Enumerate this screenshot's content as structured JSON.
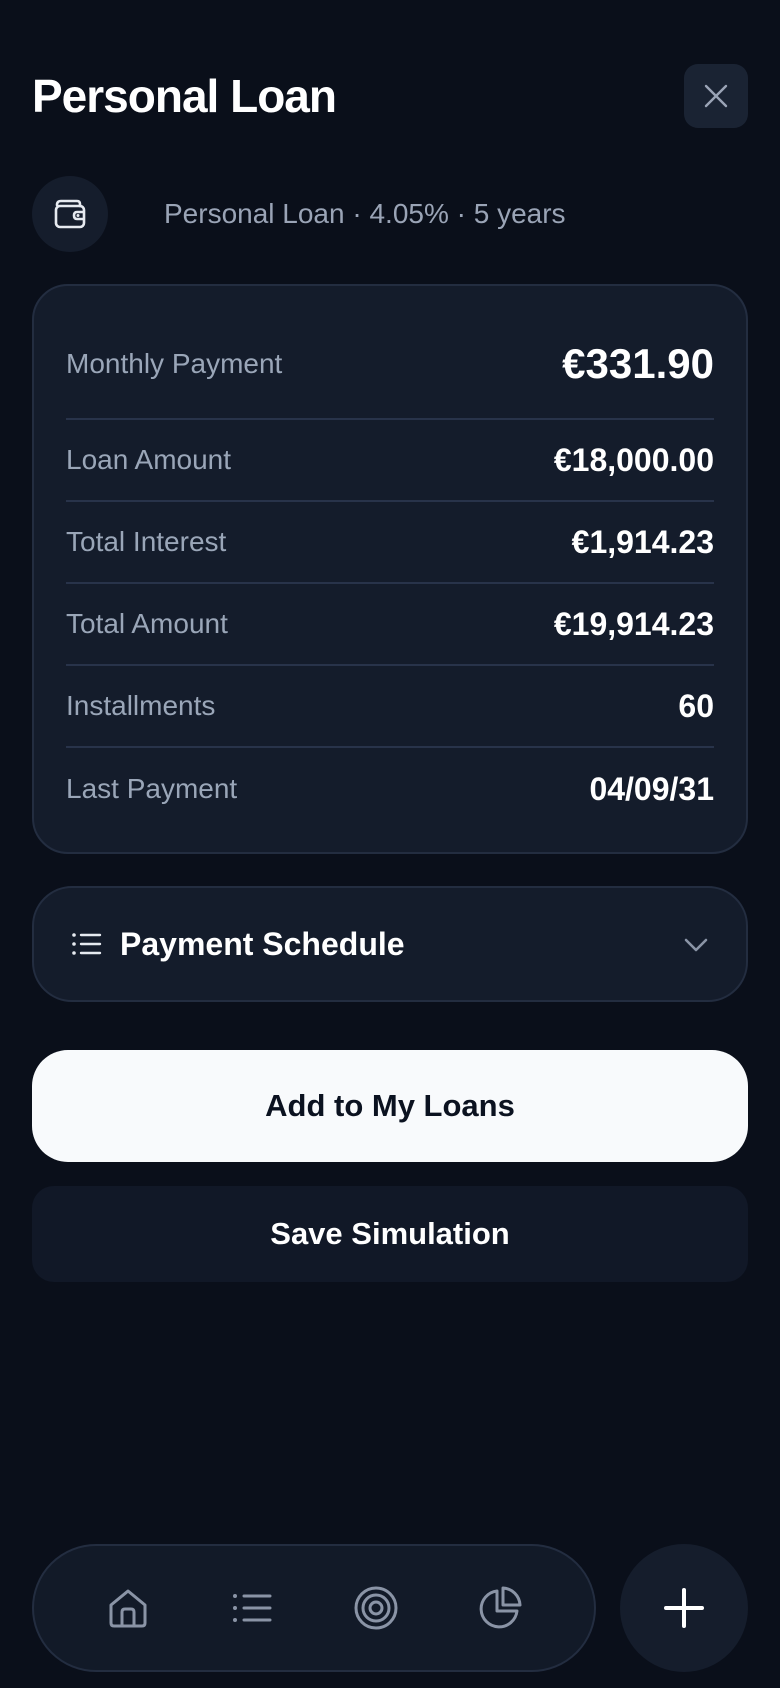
{
  "header": {
    "title": "Personal Loan",
    "close_icon": "close-icon"
  },
  "subtitle": {
    "icon": "wallet-icon",
    "text": "Personal Loan · 4.05% · 5 years"
  },
  "summary": {
    "rows": [
      {
        "label": "Monthly Payment",
        "value": "€331.90"
      },
      {
        "label": "Loan Amount",
        "value": "€18,000.00"
      },
      {
        "label": "Total Interest",
        "value": "€1,914.23"
      },
      {
        "label": "Total Amount",
        "value": "€19,914.23"
      },
      {
        "label": "Installments",
        "value": "60"
      },
      {
        "label": "Last Payment",
        "value": "04/09/31"
      }
    ]
  },
  "schedule": {
    "icon": "list-icon",
    "label": "Payment Schedule",
    "chevron": "chevron-down-icon"
  },
  "actions": {
    "primary_label": "Add to My Loans",
    "secondary_label": "Save Simulation"
  },
  "bottom_nav": {
    "items": [
      {
        "icon": "home-icon"
      },
      {
        "icon": "list-icon"
      },
      {
        "icon": "target-icon"
      },
      {
        "icon": "pie-chart-icon"
      }
    ],
    "fab_icon": "plus-icon"
  },
  "colors": {
    "background": "#0a0f1a",
    "card": "#141c2b",
    "muted_text": "#9aa6b8",
    "primary_button": "#f8fafc"
  }
}
